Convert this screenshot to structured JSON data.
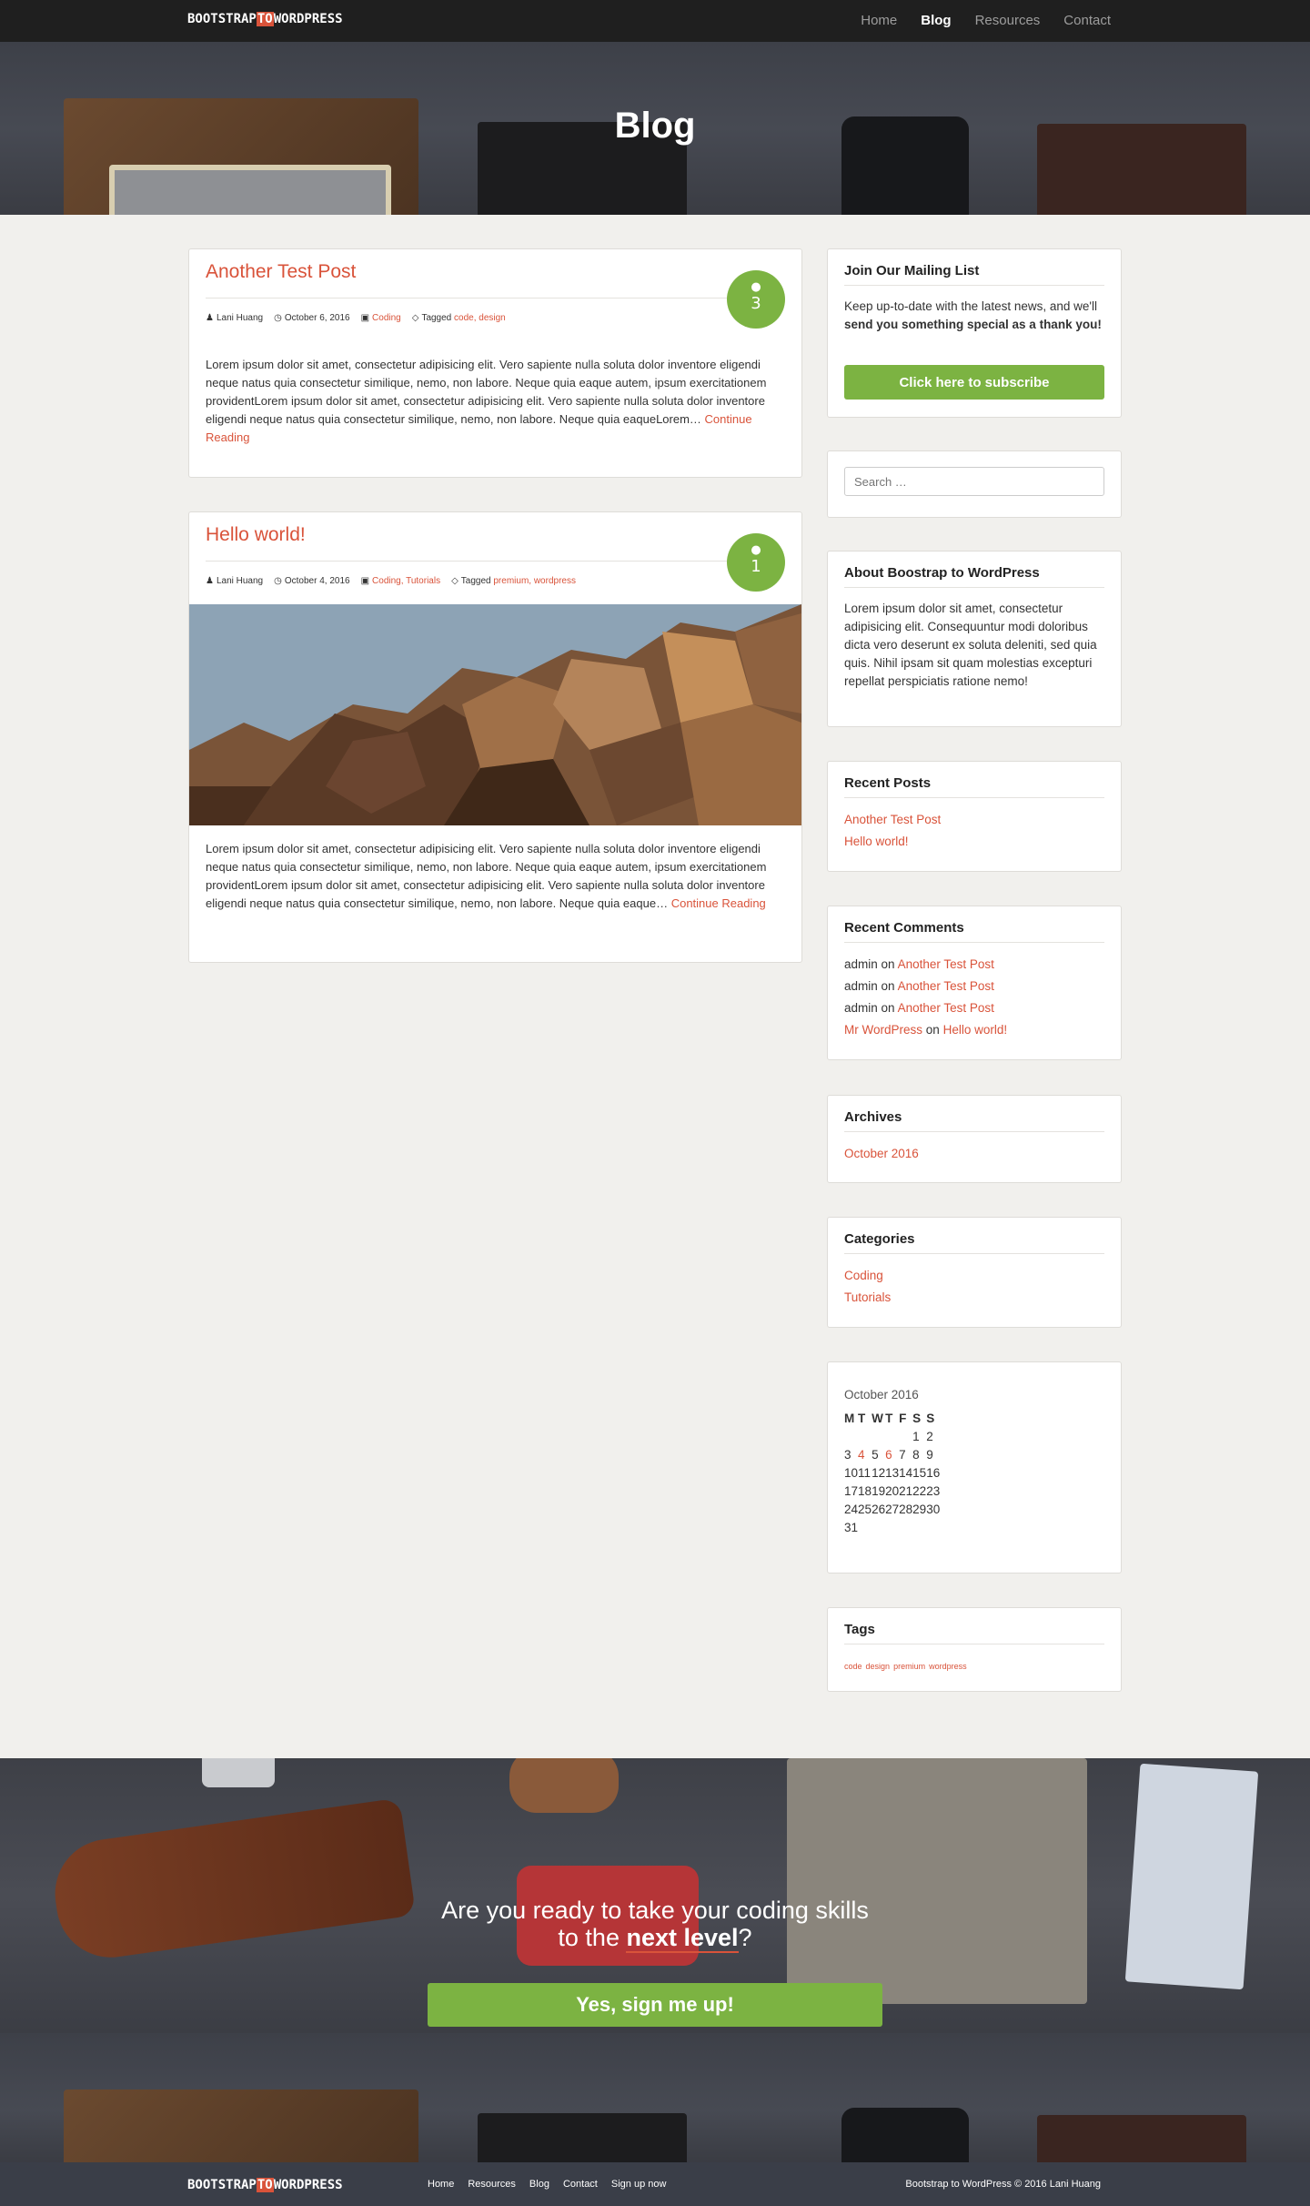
{
  "nav": {
    "brand_left": "BOOTSTRAP",
    "brand_mid": "TO",
    "brand_right": "WORDPRESS",
    "links": [
      "Home",
      "Blog",
      "Resources",
      "Contact"
    ],
    "active": "Blog"
  },
  "hero": {
    "title": "Blog"
  },
  "posts": [
    {
      "title": "Another Test Post",
      "comment_count": "3",
      "author": "Lani Huang",
      "date": "October 6, 2016",
      "categories": "Coding",
      "tagged_label": "Tagged",
      "tags": "code, design",
      "excerpt": "Lorem ipsum dolor sit amet, consectetur adipisicing elit. Vero sapiente nulla soluta dolor inventore eligendi neque natus quia consectetur similique, nemo, non labore. Neque quia eaque autem, ipsum exercitationem providentLorem ipsum dolor sit amet, consectetur adipisicing elit. Vero sapiente nulla soluta dolor inventore eligendi neque natus quia consectetur similique, nemo, non labore. Neque quia eaqueLorem…",
      "read_more": "Continue Reading"
    },
    {
      "title": "Hello world!",
      "comment_count": "1",
      "author": "Lani Huang",
      "date": "October 4, 2016",
      "categories": "Coding, Tutorials",
      "tagged_label": "Tagged",
      "tags": "premium, wordpress",
      "excerpt": "Lorem ipsum dolor sit amet, consectetur adipisicing elit. Vero sapiente nulla soluta dolor inventore eligendi neque natus quia consectetur similique, nemo, non labore. Neque quia eaque autem, ipsum exercitationem providentLorem ipsum dolor sit amet, consectetur adipisicing elit. Vero sapiente nulla soluta dolor inventore eligendi neque natus quia consectetur similique, nemo, non labore. Neque quia eaque…",
      "read_more": "Continue Reading"
    }
  ],
  "sidebar": {
    "mailing": {
      "title": "Join Our Mailing List",
      "text_a": "Keep up-to-date with the latest news, and we'll ",
      "text_b": "send you something special as a thank you!",
      "button": "Click here to subscribe"
    },
    "search": {
      "placeholder": "Search …"
    },
    "about": {
      "title": "About Boostrap to WordPress",
      "text": "Lorem ipsum dolor sit amet, consectetur adipisicing elit. Consequuntur modi doloribus dicta vero deserunt ex soluta deleniti, sed quia quis. Nihil ipsam sit quam molestias excepturi repellat perspiciatis ratione nemo!"
    },
    "recent_posts": {
      "title": "Recent Posts",
      "items": [
        "Another Test Post",
        "Hello world!"
      ]
    },
    "recent_comments": {
      "title": "Recent Comments",
      "on": "on",
      "items": [
        {
          "author": "admin",
          "post": "Another Test Post"
        },
        {
          "author": "admin",
          "post": "Another Test Post"
        },
        {
          "author": "admin",
          "post": "Another Test Post"
        },
        {
          "author": "Mr WordPress",
          "post": "Hello world!"
        }
      ]
    },
    "archives": {
      "title": "Archives",
      "items": [
        "October 2016"
      ]
    },
    "categories": {
      "title": "Categories",
      "items": [
        "Coding",
        "Tutorials"
      ]
    },
    "calendar": {
      "caption": "October 2016",
      "headers": [
        "M",
        "T",
        "W",
        "T",
        "F",
        "S",
        "S"
      ],
      "weeks": [
        [
          "",
          "",
          "",
          "",
          "",
          "1",
          "2"
        ],
        [
          "3",
          "4",
          "5",
          "6",
          "7",
          "8",
          "9"
        ],
        [
          "10",
          "11",
          "12",
          "13",
          "14",
          "15",
          "16"
        ],
        [
          "17",
          "18",
          "19",
          "20",
          "21",
          "22",
          "23"
        ],
        [
          "24",
          "25",
          "26",
          "27",
          "28",
          "29",
          "30"
        ],
        [
          "31",
          "",
          "",
          "",
          "",
          "",
          ""
        ]
      ],
      "linked_days": [
        "4",
        "6"
      ]
    },
    "tags": {
      "title": "Tags",
      "items": [
        "code",
        "design",
        "premium",
        "wordpress"
      ]
    }
  },
  "cta": {
    "line1": "Are you ready to take your coding skills",
    "line2_a": "to the ",
    "line2_b": "next level",
    "line2_c": "?",
    "button": "Yes, sign me up!"
  },
  "footer": {
    "links": [
      "Home",
      "Resources",
      "Blog",
      "Contact",
      "Sign up now"
    ],
    "copyright": "Bootstrap to WordPress © 2016 Lani Huang"
  },
  "colors": {
    "accent": "#d9533a",
    "green": "#7cb342",
    "nav_bg": "#1f1f1f",
    "footer_bg": "#3a3e48"
  }
}
